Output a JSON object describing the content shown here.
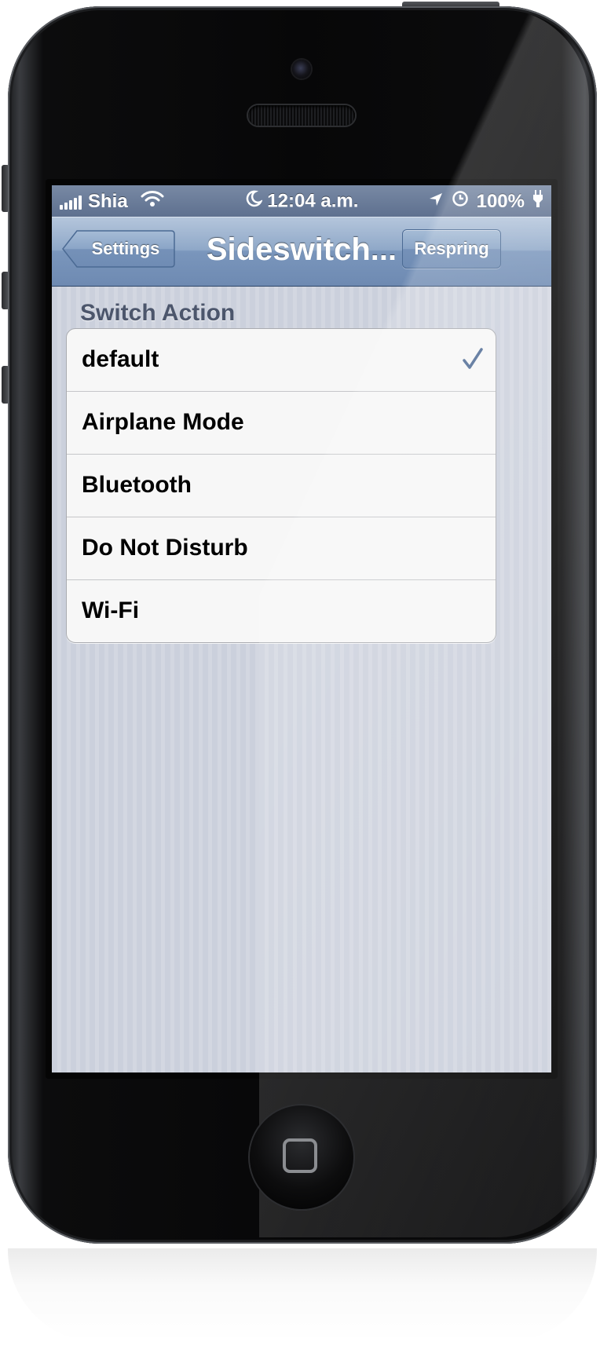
{
  "status_bar": {
    "carrier": "Shia",
    "time": "12:04 a.m.",
    "battery": "100%"
  },
  "nav_bar": {
    "back_label": "Settings",
    "title": "Sideswitch...",
    "action_label": "Respring"
  },
  "section": {
    "header": "Switch Action",
    "items": [
      {
        "label": "default",
        "selected": true
      },
      {
        "label": "Airplane Mode",
        "selected": false
      },
      {
        "label": "Bluetooth",
        "selected": false
      },
      {
        "label": "Do Not Disturb",
        "selected": false
      },
      {
        "label": "Wi-Fi",
        "selected": false
      }
    ]
  },
  "colors": {
    "nav_blue": "#7a96bc",
    "checkmark": "#4e6a94",
    "section_header": "#4c566c"
  },
  "icons": {
    "signal": "signal-bars-icon",
    "wifi": "wifi-icon",
    "moon": "moon-icon",
    "location": "location-arrow-icon",
    "alarm": "alarm-clock-icon",
    "battery": "battery-charging-icon",
    "check": "checkmark-icon",
    "home": "home-button-icon"
  }
}
